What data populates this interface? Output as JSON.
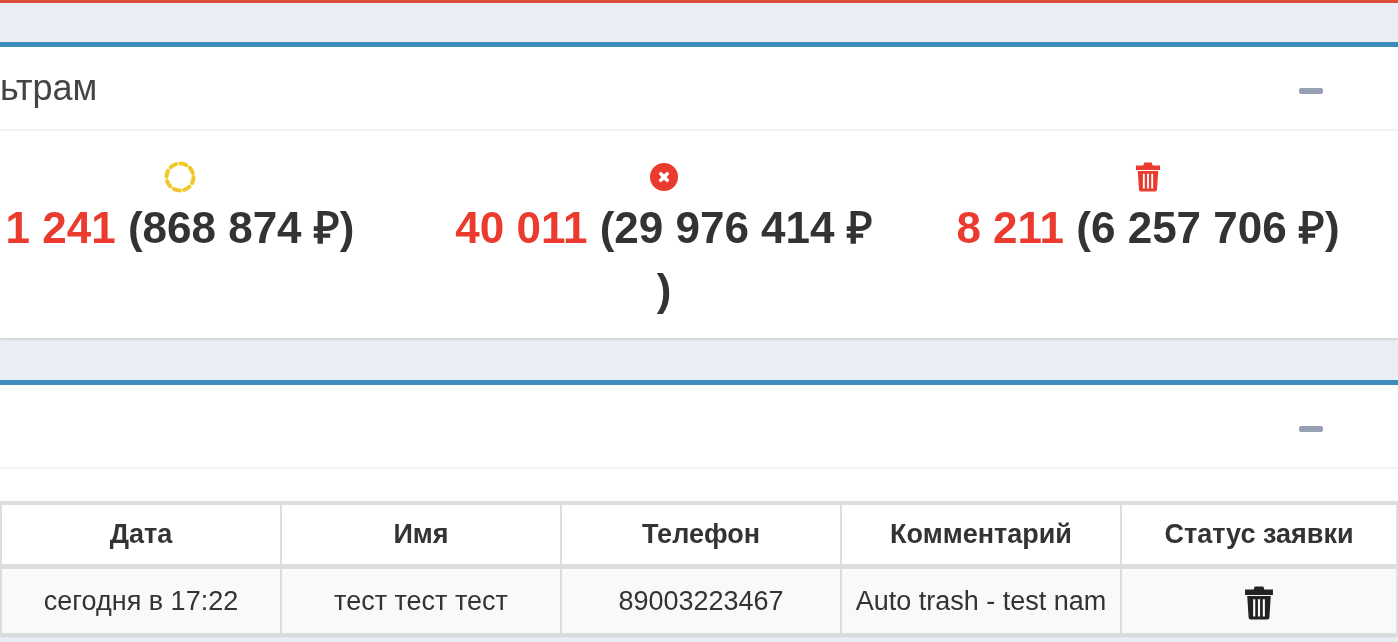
{
  "stats_panel": {
    "title": "ьтрам",
    "expanded": true,
    "stats": [
      {
        "kind": "ring",
        "color": "#f0c828",
        "count": "1 241",
        "amount": "(868 874 ₽)"
      },
      {
        "kind": "cross",
        "color": "#ea3b2e",
        "count": "40 011",
        "amount": "(29 976 414 ₽)"
      },
      {
        "kind": "trash",
        "color": "#ea3b2e",
        "count": "8 211",
        "amount": "(6 257 706 ₽)"
      }
    ]
  },
  "requests_panel": {
    "expanded": true,
    "table": {
      "columns": [
        "Дата",
        "Имя",
        "Телефон",
        "Комментарий",
        "Статус заявки"
      ],
      "rows": [
        {
          "cells": [
            "сегодня в 17:22",
            "тест тест тест",
            "89003223467",
            "Auto trash - test nam"
          ],
          "trashed": true
        }
      ]
    }
  }
}
